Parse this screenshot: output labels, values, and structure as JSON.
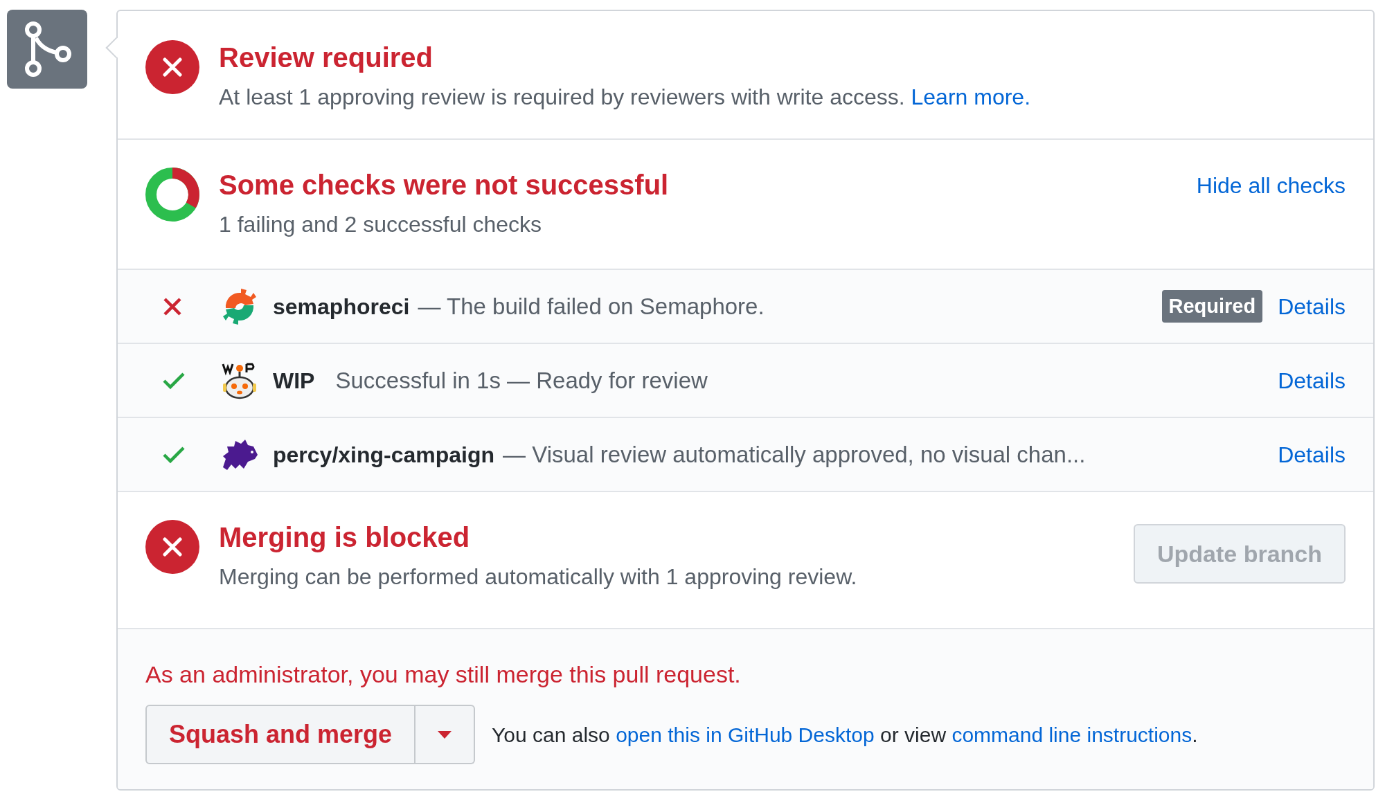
{
  "review": {
    "kind": "failure",
    "title": "Review required",
    "parts": [
      {
        "kind": "text",
        "text": "At least 1 approving review is required by reviewers with write access. "
      },
      {
        "kind": "link",
        "text": "Learn more."
      }
    ]
  },
  "checks": {
    "kind": "partial",
    "title": "Some checks were not successful",
    "subtitle": "1 failing and 2 successful checks",
    "toggle": "Hide all checks",
    "items": [
      {
        "status": {
          "kind": "failure"
        },
        "app": {
          "kind": "semaphore"
        },
        "name": "semaphoreci",
        "description": "— The build failed on Semaphore.",
        "badge": "Required",
        "link": "Details"
      },
      {
        "status": {
          "kind": "success"
        },
        "app": {
          "kind": "wip"
        },
        "name": "WIP",
        "description": "Successful in 1s — Ready for review",
        "link": "Details"
      },
      {
        "status": {
          "kind": "success"
        },
        "app": {
          "kind": "percy"
        },
        "name": "percy/xing-campaign",
        "description": "— Visual review automatically approved, no visual chan...",
        "link": "Details"
      }
    ]
  },
  "merge_status": {
    "kind": "failure",
    "title": "Merging is blocked",
    "description": "Merging can be performed automatically with 1 approving review.",
    "button": {
      "label": "Update branch",
      "disabled": true
    }
  },
  "admin": {
    "notice": "As an administrator, you may still merge this pull request.",
    "merge_button": "Squash and merge",
    "parts": [
      {
        "kind": "text",
        "text": "You can also "
      },
      {
        "kind": "link",
        "text": "open this in GitHub Desktop"
      },
      {
        "kind": "text",
        "text": " or view "
      },
      {
        "kind": "link",
        "text": "command line instructions"
      },
      {
        "kind": "text",
        "text": "."
      }
    ]
  }
}
